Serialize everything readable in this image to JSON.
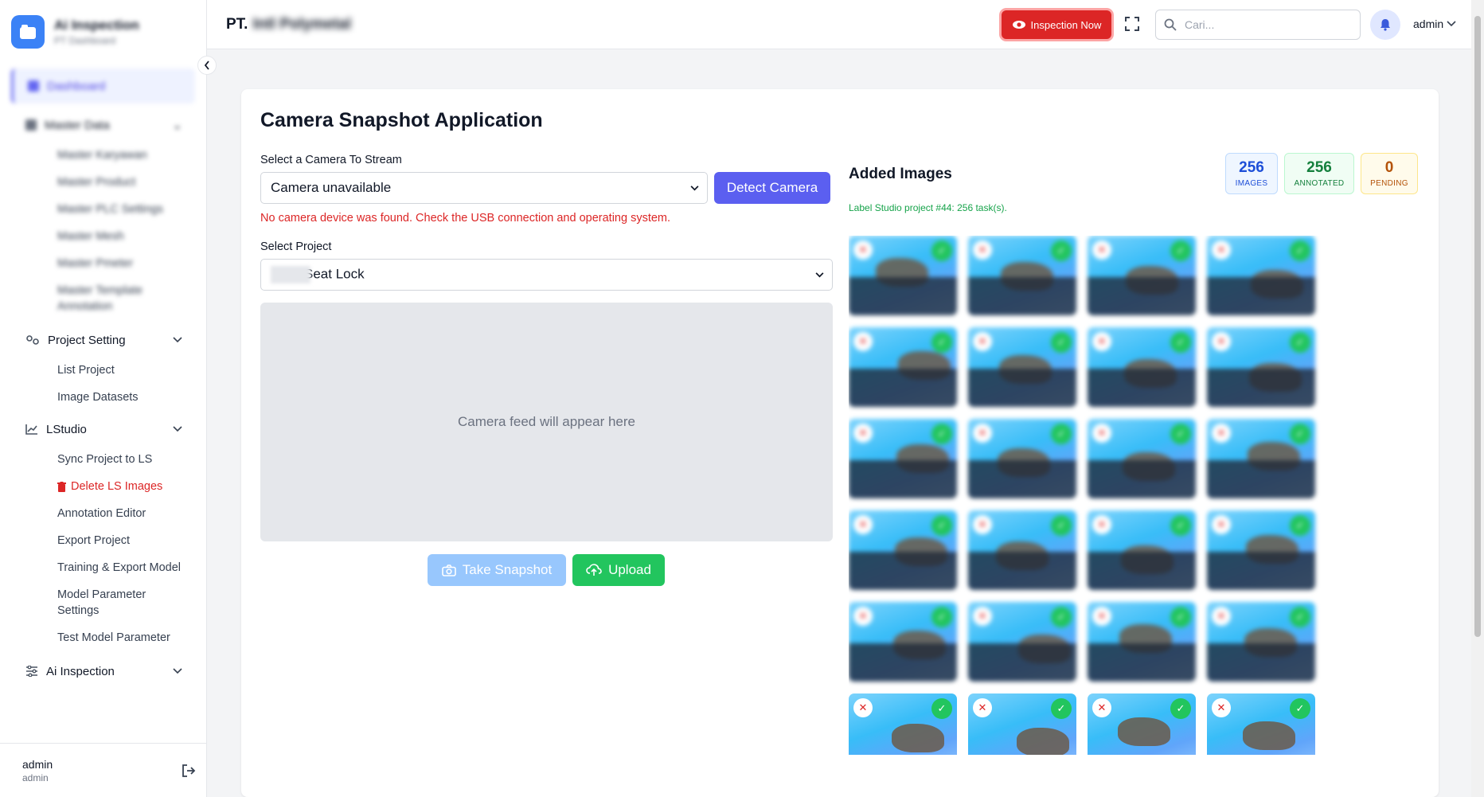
{
  "sidebar": {
    "brand_title": "Ai Inspection",
    "brand_sub": "PT Dashboard",
    "dashboard_label": "Dashboard",
    "master_data": {
      "label": "Master Data",
      "items": [
        "Master Karyawan",
        "Master Product",
        "Master PLC Settings",
        "Master Mesh",
        "Master Pmeter",
        "Master Template Annotation"
      ]
    },
    "project_setting": {
      "label": "Project Setting",
      "items": [
        "List Project",
        "Image Datasets"
      ]
    },
    "lstudio": {
      "label": "LStudio",
      "items": [
        "Sync Project to LS",
        "Delete LS Images",
        "Annotation Editor",
        "Export Project",
        "Training & Export Model",
        "Model Parameter Settings",
        "Test Model Parameter"
      ]
    },
    "ai_inspection": {
      "label": "Ai Inspection"
    },
    "footer": {
      "name": "admin",
      "role": "admin"
    }
  },
  "header": {
    "company_prefix": "PT.",
    "company_name": "Intl Polymetal",
    "inspect_label": "Inspection Now",
    "search_placeholder": "Cari...",
    "user": "admin"
  },
  "main": {
    "title": "Camera Snapshot Application",
    "camera_label": "Select a Camera To Stream",
    "camera_value": "Camera unavailable",
    "detect_label": "Detect Camera",
    "error": "No camera device was found. Check the USB connection and operating system.",
    "project_label": "Select Project",
    "project_value": "Seat Lock",
    "feed_placeholder": "Camera feed will appear here",
    "snapshot_label": "Take Snapshot",
    "upload_label": "Upload",
    "added_title": "Added Images",
    "ls_info": "Label Studio project #44: 256 task(s).",
    "stats": [
      {
        "num": "256",
        "cap": "IMAGES"
      },
      {
        "num": "256",
        "cap": "ANNOTATED"
      },
      {
        "num": "0",
        "cap": "PENDING"
      }
    ],
    "tile_count": 24
  },
  "colors": {
    "primary": "#5b5ff0",
    "danger": "#dc2626",
    "success": "#22c55e"
  }
}
